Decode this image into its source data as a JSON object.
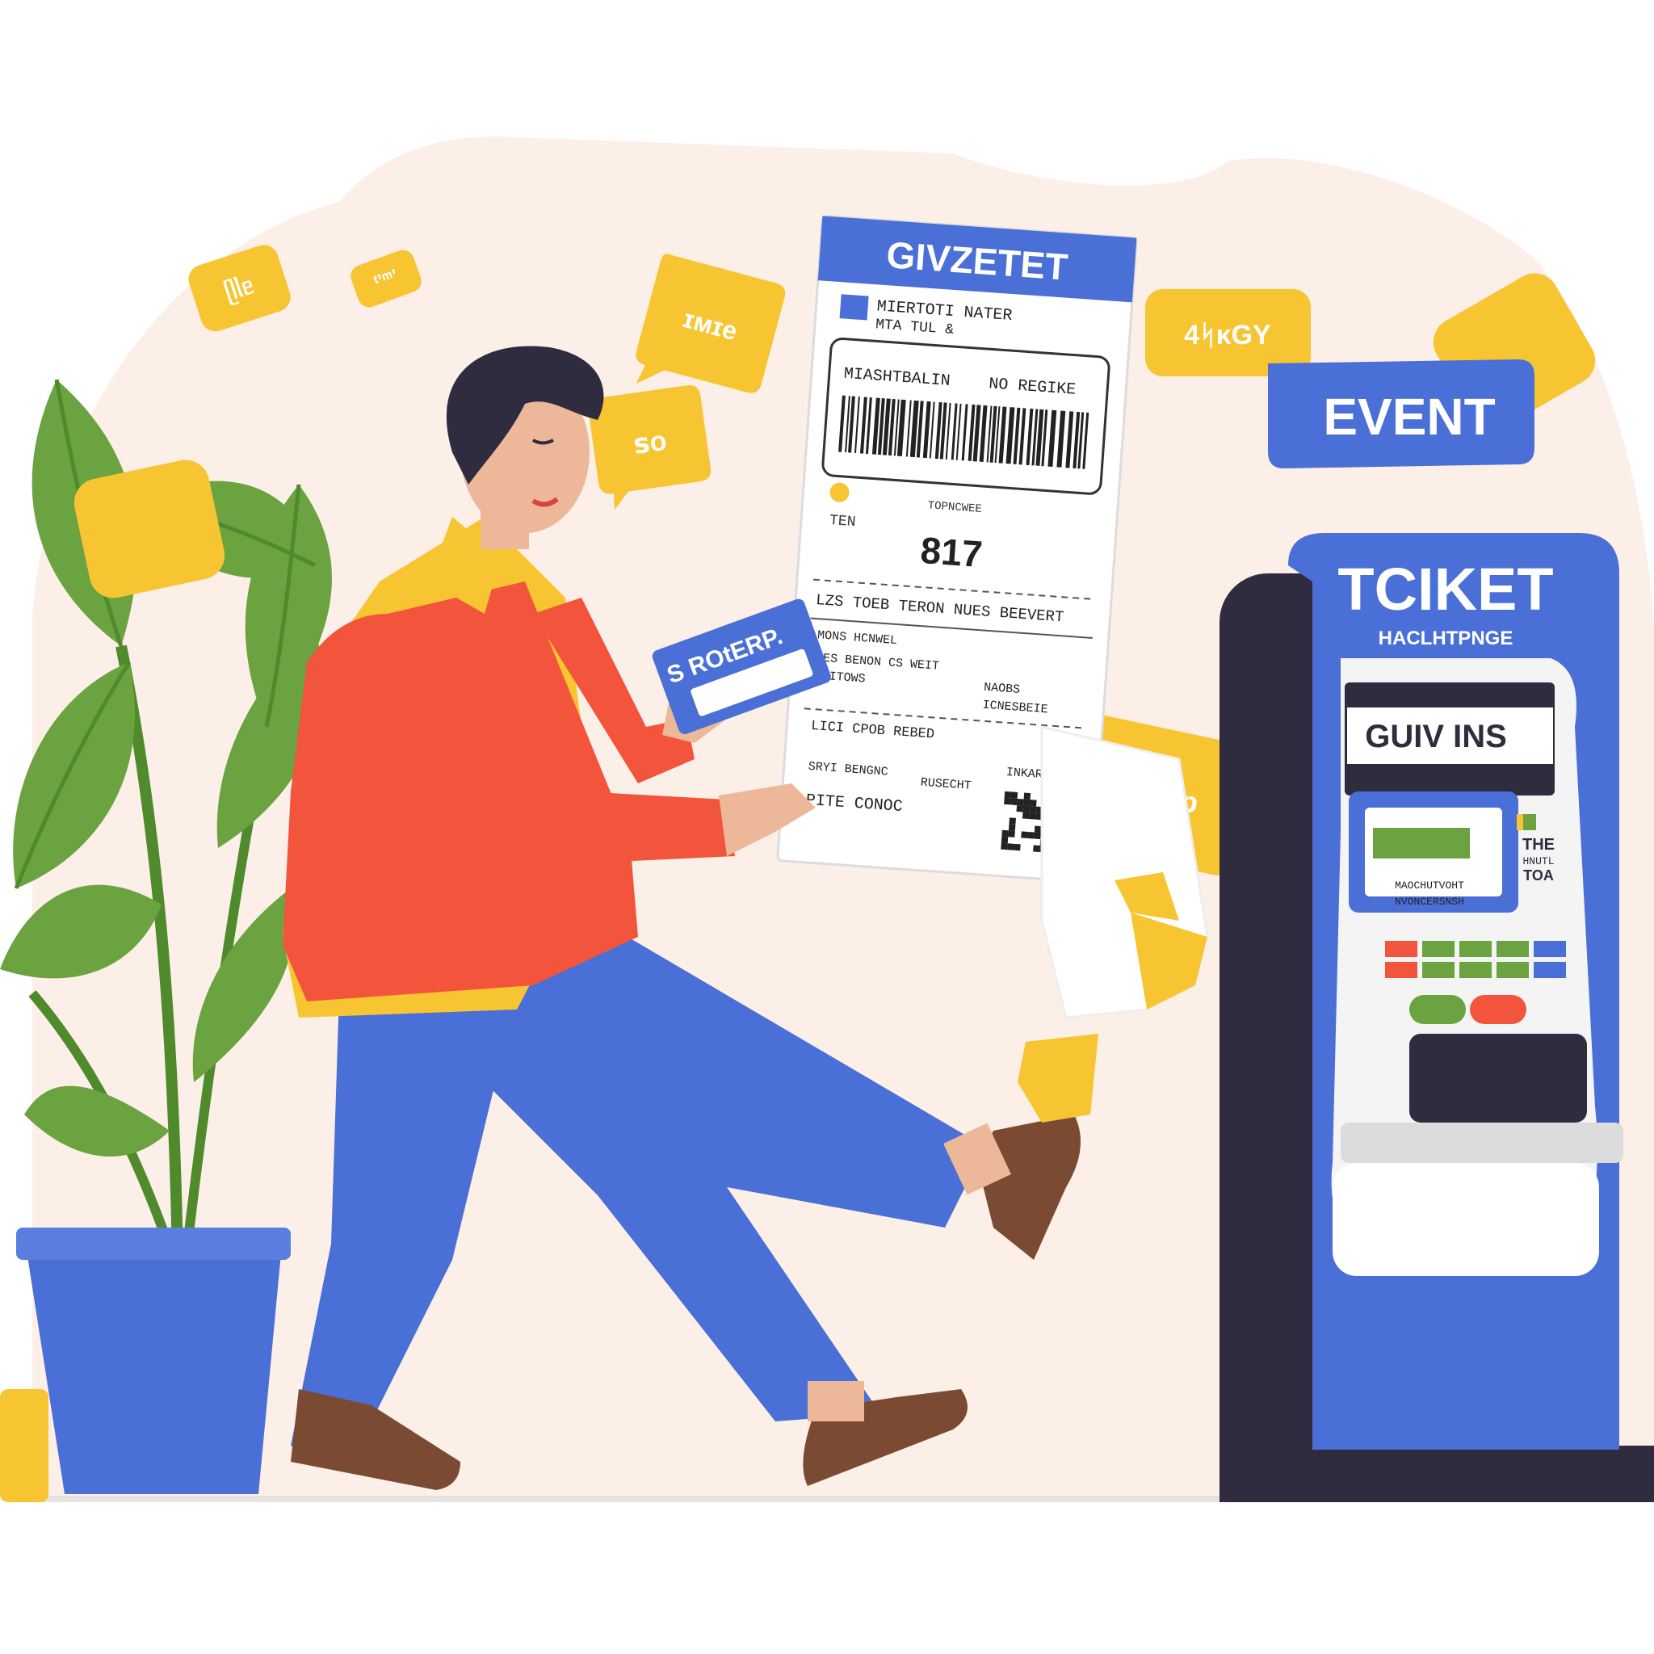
{
  "colors": {
    "blob": "#fcefe7",
    "yellow": "#f7c532",
    "blue": "#4a6fd6",
    "red": "#f2553b",
    "navy": "#2f2c3f",
    "green": "#6aa33f",
    "leaf_dark": "#4f8a2c",
    "skin": "#edb79a",
    "brown": "#7a4a33"
  },
  "bubbles": {
    "b1": "ᥫᥣᥱ",
    "b2": "ᵗ’ᵐ’",
    "b3": "ɪᴍɪe",
    "b4": "ꜱᴏ",
    "b5": "4ᛋᴋGY",
    "b6": "SRIDp"
  },
  "event_tag": "EVENT",
  "card_label": "S ROtERP.",
  "ticket": {
    "header": "GIVZETET",
    "org_line1": "MIERTOTI NATER",
    "org_line2": "MTA TUL &",
    "name_label": "MIASHTBALIN",
    "no_label": "NO REGIKE",
    "small_tag": "TOPNCWEE",
    "ten": "TEN",
    "number": "817",
    "line_a": "LZS TOEB TERON NUES BEEVERT",
    "line_b": "MONS HCNWEL",
    "line_c": "IES BENON CS WEIT",
    "line_d": "IFITOWS",
    "line_e": "NAOBS",
    "line_f": "ICNESBEIE",
    "line_g": "LICI CPOB REBED",
    "line_h": "SRYI BENGNC",
    "line_i": "RUSECHT",
    "line_j": "INKARCH",
    "line_k": "PITE CONOC"
  },
  "kiosk": {
    "title": "TCIKET",
    "subtitle": "HACLHTPNGE",
    "screen_text": "GUIV INS",
    "line1": "MAOCHUTVOHT",
    "line2": "NVONCERSNSH",
    "side_text1": "THE",
    "side_text2": "HNUTL",
    "side_text3": "TOA"
  }
}
